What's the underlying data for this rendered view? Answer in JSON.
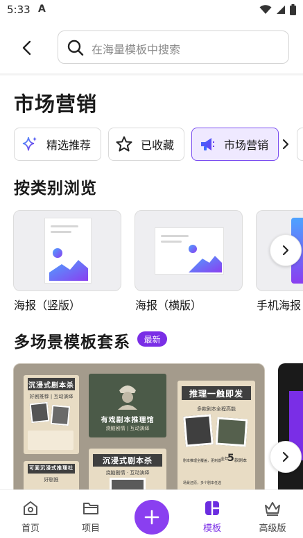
{
  "status_bar": {
    "time": "5:33",
    "a_label": "A"
  },
  "search": {
    "placeholder": "在海量模板中搜索"
  },
  "page_title": "市场营销",
  "chips": [
    {
      "label": "精选推荐",
      "icon": "sparkle-icon"
    },
    {
      "label": "已收藏",
      "icon": "star-outline-icon"
    },
    {
      "label": "市场营销",
      "icon": "megaphone-icon",
      "active": true
    }
  ],
  "browse": {
    "title": "按类别浏览",
    "items": [
      {
        "label": "海报（竖版）"
      },
      {
        "label": "海报（横版）"
      },
      {
        "label": "手机海报"
      }
    ]
  },
  "scenes": {
    "title": "多场景模板套系",
    "badge": "最新",
    "poster_texts": {
      "p1_title": "沉浸式剧本杀",
      "p1_sub": "好剧推荐 | 互动演绎",
      "p2_title": "有戏剧本推理馆",
      "p2_sub": "烧脑剧情 | 互动演绎",
      "p3_title": "推理一触即发",
      "p3_sub": "多款剧本全程高能",
      "p4_title": "沉浸式剧本杀",
      "p4_sub": "烧脑剧情 · 互动演绎",
      "p5_title": "可面沉浸式推理社",
      "p5_sub": "好剧推",
      "p3_item1": "剧本推理全覆盖，更刺激",
      "p3_item2": "5",
      "p3_item3": "场景还原，多个剧本任选",
      "p3_badge": "全年",
      "p3_badge2": "款剧本"
    }
  },
  "nav": {
    "items": [
      {
        "label": "首页",
        "icon": "home-icon"
      },
      {
        "label": "项目",
        "icon": "folder-icon"
      },
      {
        "label": "模板",
        "icon": "template-icon",
        "active": true
      },
      {
        "label": "高级版",
        "icon": "crown-icon"
      }
    ]
  },
  "colors": {
    "accent": "#7a2ee6",
    "chip_active_bg": "#efe9ff"
  }
}
